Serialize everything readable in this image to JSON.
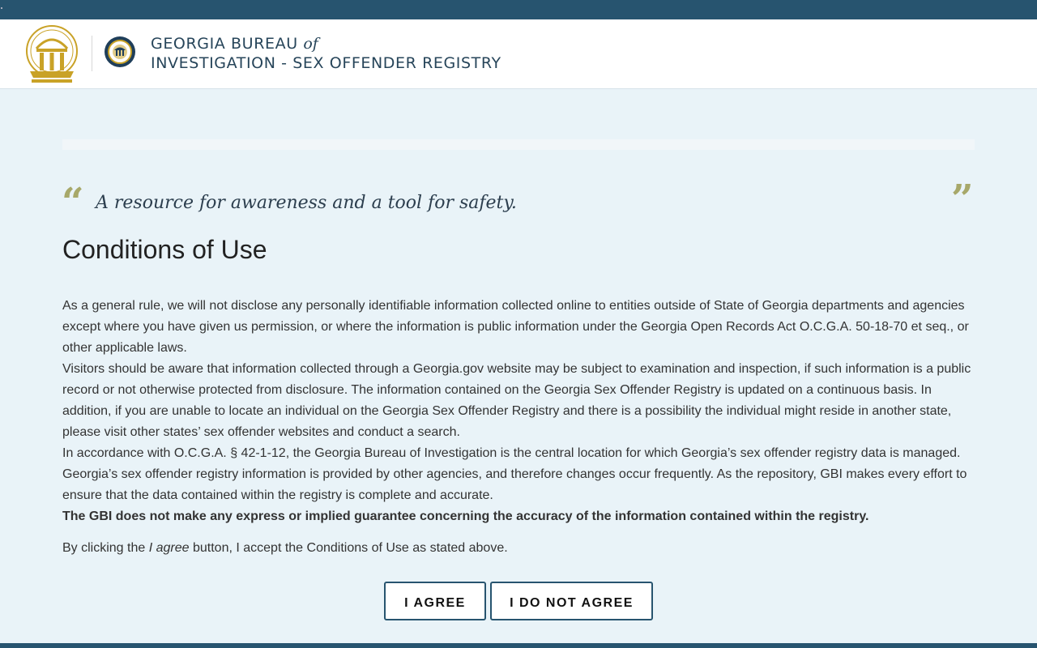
{
  "header": {
    "title_line1_pre": "GEORGIA BUREAU",
    "title_line1_of": "of",
    "title_line2": "INVESTIGATION - SEX OFFENDER REGISTRY"
  },
  "tagline": "A resource for awareness and a tool for safety.",
  "page_title": "Conditions of Use",
  "paragraphs": [
    "As a general rule, we will not disclose any personally identifiable information collected online to entities outside of State of Georgia departments and agencies except where you have given us permission, or where the information is public information under the Georgia Open Records Act O.C.G.A. 50-18-70 et seq., or other applicable laws.",
    "Visitors should be aware that information collected through a Georgia.gov website may be subject to examination and inspection, if such information is a public record or not otherwise protected from disclosure. The information contained on the Georgia Sex Offender Registry is updated on a continuous basis. In addition, if you are unable to locate an individual on the Georgia Sex Offender Registry and there is a possibility the individual might reside in another state, please visit other states’ sex offender websites and conduct a search.",
    "In accordance with O.C.G.A. § 42-1-12, the Georgia Bureau of Investigation is the central location for which Georgia’s sex offender registry data is managed. Georgia’s sex offender registry information is provided by other agencies, and therefore changes occur frequently. As the repository, GBI makes every effort to ensure that the data contained within the registry is complete and accurate.",
    "The GBI does not make any express or implied guarantee concerning the accuracy of the information contained within the registry."
  ],
  "accept": {
    "pre": "By clicking the ",
    "em": "I agree",
    "post": " button, I accept the Conditions of Use as stated above."
  },
  "buttons": {
    "agree": "I AGREE",
    "disagree": "I DO NOT AGREE"
  },
  "colors": {
    "navy": "#27546f",
    "gold": "#c9a227",
    "quote_olive": "#a7a86a",
    "page_bg": "#e9f3f8"
  },
  "icons": {
    "state_seal": "georgia-arch-seal-icon",
    "gbi_seal": "gbi-seal-icon",
    "quote_open": "open-quote-icon",
    "quote_close": "close-quote-icon"
  }
}
